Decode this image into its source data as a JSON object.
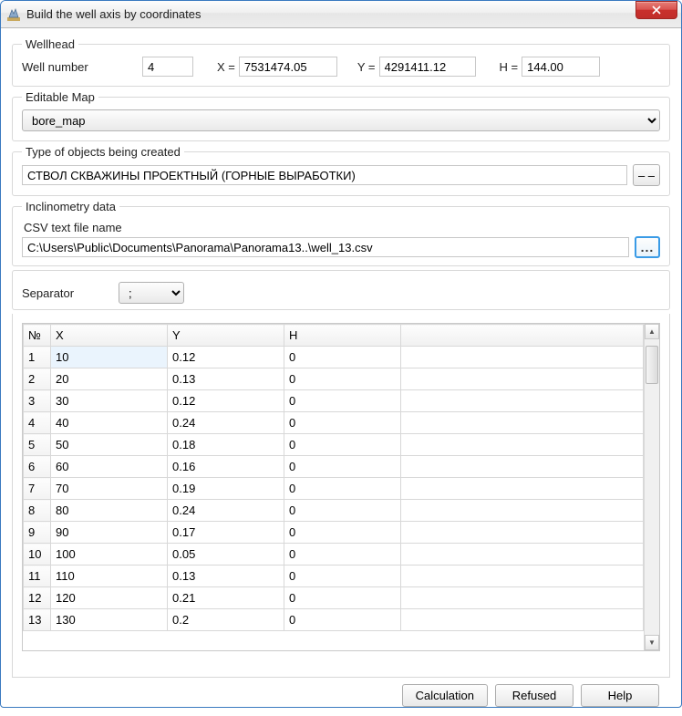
{
  "window": {
    "title": "Build the well axis by coordinates"
  },
  "wellhead": {
    "legend": "Wellhead",
    "well_number_label": "Well number",
    "well_number": "4",
    "x_label": "X =",
    "x": "7531474.05",
    "y_label": "Y =",
    "y": "4291411.12",
    "h_label": "H =",
    "h": "144.00"
  },
  "editable_map": {
    "legend": "Editable Map",
    "value": "bore_map"
  },
  "object_type": {
    "legend": "Type of objects being created",
    "value": "СТВОЛ СКВАЖИНЫ ПРОЕКТНЫЙ (ГОРНЫЕ ВЫРАБОТКИ)",
    "button": "– –"
  },
  "inclinometry": {
    "legend": "Inclinometry data",
    "csv_label": "CSV text file name",
    "csv_path": "C:\\Users\\Public\\Documents\\Panorama\\Panorama13..\\well_13.csv",
    "browse": "..."
  },
  "separator": {
    "label": "Separator",
    "value": ";"
  },
  "table": {
    "headers": {
      "n": "№",
      "x": "X",
      "y": "Y",
      "h": "H"
    },
    "rows": [
      {
        "n": "1",
        "x": "10",
        "y": "0.12",
        "h": "0"
      },
      {
        "n": "2",
        "x": "20",
        "y": "0.13",
        "h": "0"
      },
      {
        "n": "3",
        "x": "30",
        "y": "0.12",
        "h": "0"
      },
      {
        "n": "4",
        "x": "40",
        "y": "0.24",
        "h": "0"
      },
      {
        "n": "5",
        "x": "50",
        "y": "0.18",
        "h": "0"
      },
      {
        "n": "6",
        "x": "60",
        "y": "0.16",
        "h": "0"
      },
      {
        "n": "7",
        "x": "70",
        "y": "0.19",
        "h": "0"
      },
      {
        "n": "8",
        "x": "80",
        "y": "0.24",
        "h": "0"
      },
      {
        "n": "9",
        "x": "90",
        "y": "0.17",
        "h": "0"
      },
      {
        "n": "10",
        "x": "100",
        "y": "0.05",
        "h": "0"
      },
      {
        "n": "11",
        "x": "110",
        "y": "0.13",
        "h": "0"
      },
      {
        "n": "12",
        "x": "120",
        "y": "0.21",
        "h": "0"
      },
      {
        "n": "13",
        "x": "130",
        "y": "0.2",
        "h": "0"
      }
    ]
  },
  "buttons": {
    "calculation": "Calculation",
    "refused": "Refused",
    "help": "Help"
  }
}
